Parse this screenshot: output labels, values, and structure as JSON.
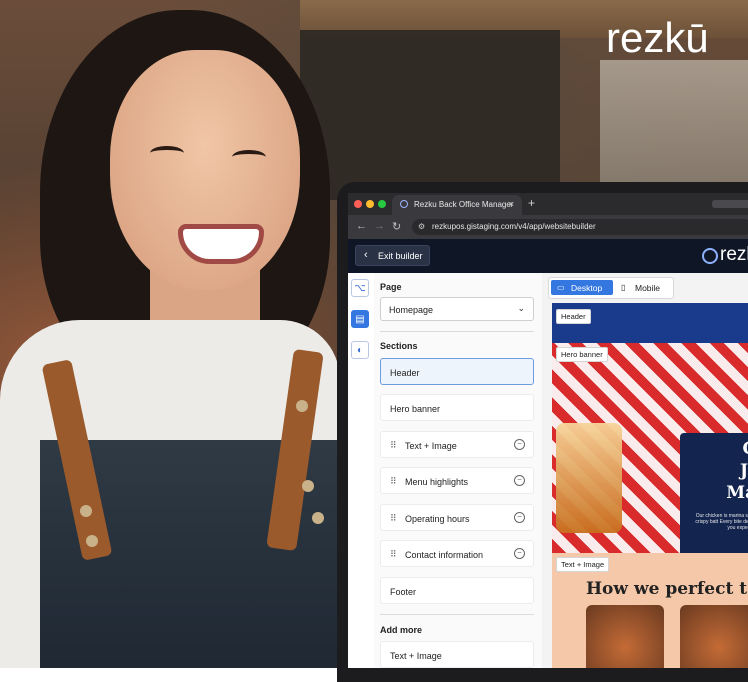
{
  "brand": {
    "logo_text": "rezkū"
  },
  "browser": {
    "tab_title": "Rezku Back Office Manager",
    "tab_close": "×",
    "new_tab": "+",
    "url": "rezkupos.gistaging.com/v4/app/websitebuilder"
  },
  "builder": {
    "exit_label": "Exit builder",
    "app_logo": "rezku",
    "page_label": "Page",
    "page_value": "Homepage",
    "sections_label": "Sections",
    "sections": [
      {
        "label": "Header"
      },
      {
        "label": "Hero banner"
      },
      {
        "label": "Text + Image"
      },
      {
        "label": "Menu highlights"
      },
      {
        "label": "Operating hours"
      },
      {
        "label": "Contact information"
      },
      {
        "label": "Footer"
      }
    ],
    "add_more_label": "Add more",
    "add_more_items": [
      {
        "label": "Text + Image"
      }
    ]
  },
  "preview": {
    "desktop_label": "Desktop",
    "mobile_label": "Mobile",
    "tags": {
      "header": "Header",
      "hero": "Hero banner",
      "text_image": "Text + Image"
    },
    "hero_lines": [
      "C",
      "J",
      "Mad"
    ],
    "hero_body": "Our chicken is marina signature crispy batt Every bite delivers th you expect—fast,",
    "section_heading": "How we perfect t"
  },
  "colors": {
    "accent": "#3477e0",
    "app_header": "#0f1626",
    "hero_card": "#13244f"
  }
}
